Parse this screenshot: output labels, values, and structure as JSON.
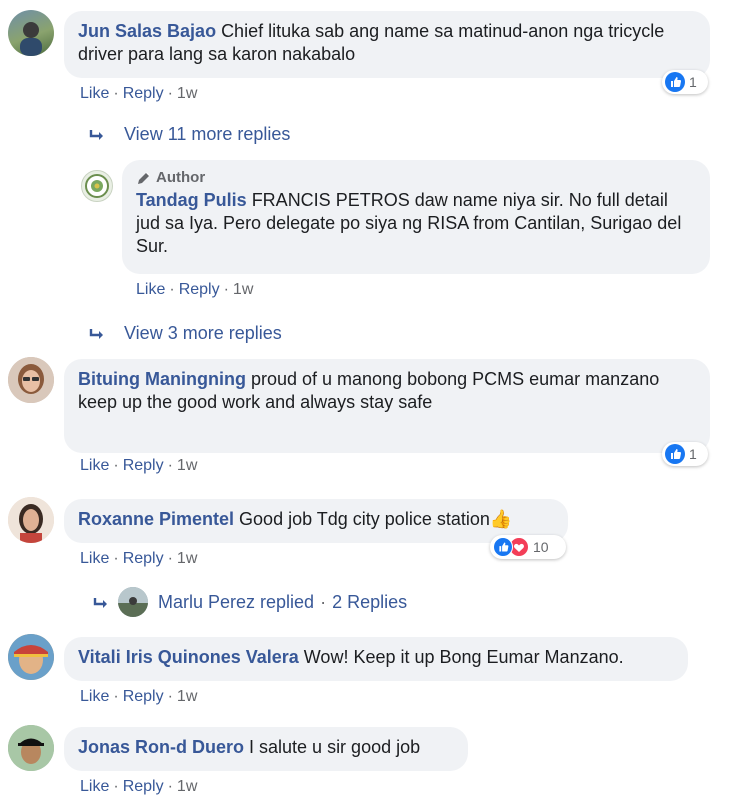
{
  "comments": [
    {
      "name": "Jun Salas Bajao",
      "text": "Chief lituka sab ang name sa matinud-anon nga tricycle driver para lang sa karon nakabalo",
      "like": "Like",
      "reply": "Reply",
      "time": "1w",
      "reaction_count": "1",
      "more_replies": "View 11 more replies"
    },
    {
      "author_tag": "Author",
      "name": "Tandag Pulis",
      "text": "FRANCIS PETROS daw name niya sir. No full detail jud sa Iya. Pero delegate po siya ng RISA from Cantilan, Surigao del Sur.",
      "like": "Like",
      "reply": "Reply",
      "time": "1w",
      "more_replies": "View 3 more replies"
    },
    {
      "name": "Bituing Maningning",
      "text_line1": "proud of u manong bobong PCMS eumar manzano",
      "text_line2": "keep up the good work and always stay safe",
      "like": "Like",
      "reply": "Reply",
      "time": "1w",
      "reaction_count": "1"
    },
    {
      "name": "Roxanne Pimentel",
      "text": "Good job Tdg city police station👍",
      "like": "Like",
      "reply": "Reply",
      "time": "1w",
      "reaction_count": "10",
      "replied_by": "Marlu Perez replied",
      "replies_count": "2 Replies"
    },
    {
      "name": "Vitali Iris Quinones Valera",
      "text": "Wow! Keep it up Bong Eumar Manzano.",
      "like": "Like",
      "reply": "Reply",
      "time": "1w"
    },
    {
      "name": "Jonas Ron-d Duero",
      "text": "I salute u sir good job",
      "like": "Like",
      "reply": "Reply",
      "time": "1w"
    }
  ],
  "separator": "·",
  "colors": {
    "link": "#385898",
    "bubble": "#f0f2f5",
    "like_blue": "#1877f2",
    "love_red": "#f33e58"
  },
  "icons": {
    "reply_arrow": "reply-arrow-icon",
    "like": "like-reaction-icon",
    "love": "love-reaction-icon",
    "pencil": "pencil-icon"
  }
}
